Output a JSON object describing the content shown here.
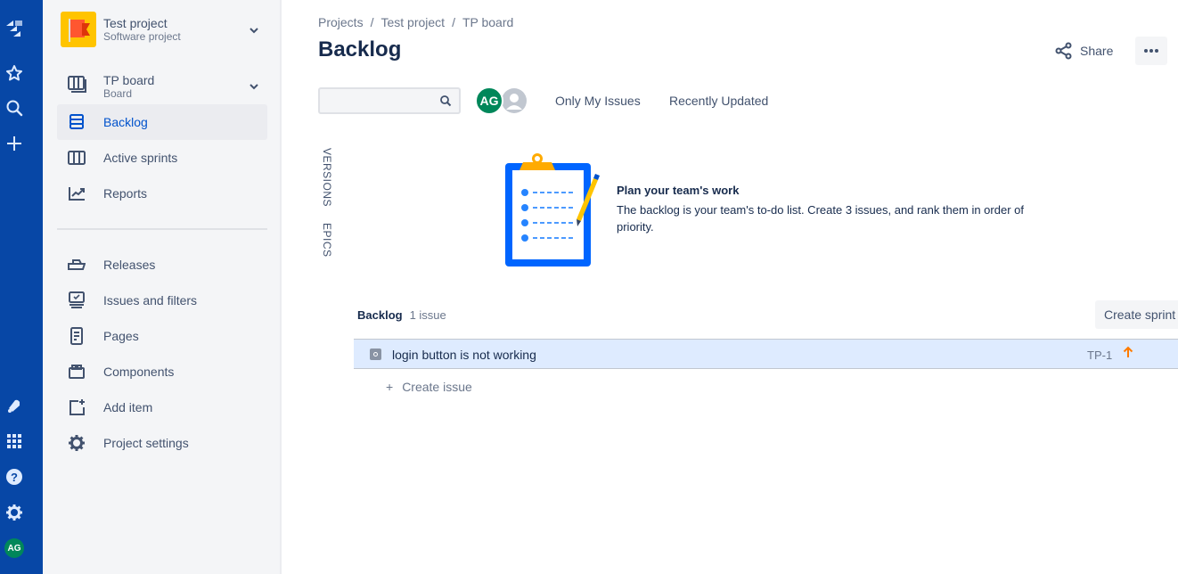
{
  "global_nav": {
    "icons": [
      "jira-logo-icon",
      "star-icon",
      "search-icon",
      "create-plus-icon",
      "notification-icon",
      "app-switcher-icon",
      "help-icon",
      "settings-icon"
    ],
    "user_initials": "AG"
  },
  "sidebar": {
    "project_name": "Test project",
    "project_type": "Software project",
    "board_name": "TP board",
    "board_type": "Board",
    "items": [
      {
        "label": "Backlog",
        "icon": "backlog-icon",
        "active": true
      },
      {
        "label": "Active sprints",
        "icon": "board-icon",
        "active": false
      },
      {
        "label": "Reports",
        "icon": "reports-icon",
        "active": false
      },
      {
        "label": "Releases",
        "icon": "ship-icon",
        "active": false
      },
      {
        "label": "Issues and filters",
        "icon": "issues-icon",
        "active": false
      },
      {
        "label": "Pages",
        "icon": "page-icon",
        "active": false
      },
      {
        "label": "Components",
        "icon": "component-icon",
        "active": false
      },
      {
        "label": "Add item",
        "icon": "add-item-icon",
        "active": false
      },
      {
        "label": "Project settings",
        "icon": "settings-icon",
        "active": false
      }
    ]
  },
  "header": {
    "breadcrumbs": [
      "Projects",
      "Test project",
      "TP board"
    ],
    "title": "Backlog",
    "share_label": "Share"
  },
  "filters": {
    "search_placeholder": "",
    "avatar_initials": "AG",
    "quick_filters": [
      "Only My Issues",
      "Recently Updated"
    ]
  },
  "side_tabs": [
    "VERSIONS",
    "EPICS"
  ],
  "empty_state": {
    "title": "Plan your team's work",
    "description": "The backlog is your team's to-do list. Create 3 issues, and rank them in order of priority."
  },
  "backlog": {
    "title": "Backlog",
    "count_label": "1 issue",
    "create_sprint_label": "Create sprint",
    "issues": [
      {
        "summary": "login button is not working",
        "key": "TP-1",
        "type": "task",
        "priority": "high"
      }
    ],
    "create_issue_label": "Create issue"
  },
  "colors": {
    "global_nav": "#0747a6",
    "accent": "#0052cc",
    "avatar": "#00875a",
    "selected_row": "#deebff",
    "priority_high": "#ff7a00",
    "project_avatar": "#ffc400"
  }
}
